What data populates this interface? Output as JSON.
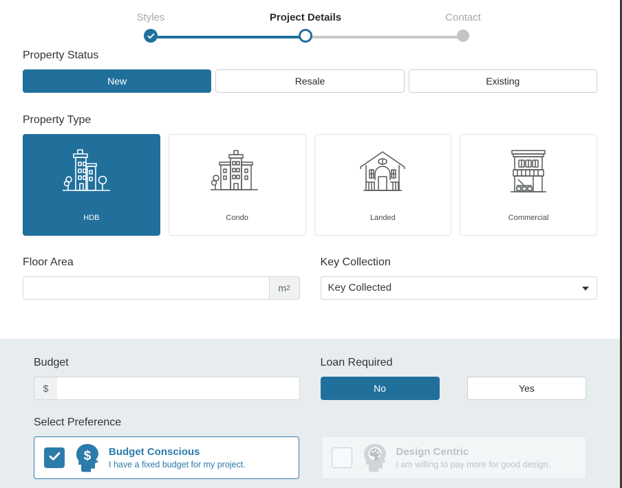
{
  "theme": {
    "accent": "#21709c",
    "accent_light": "#2b7bab",
    "panel_bg": "#e7ecef",
    "muted": "#bcc3c7"
  },
  "stepper": {
    "steps": [
      {
        "label": "Styles",
        "state": "done",
        "icon": "check-icon"
      },
      {
        "label": "Project Details",
        "state": "active",
        "icon": "circle-icon"
      },
      {
        "label": "Contact",
        "state": "todo",
        "icon": "dot-icon"
      }
    ]
  },
  "property_status": {
    "label": "Property Status",
    "options": [
      {
        "label": "New",
        "selected": true
      },
      {
        "label": "Resale",
        "selected": false
      },
      {
        "label": "Existing",
        "selected": false
      }
    ]
  },
  "property_type": {
    "label": "Property Type",
    "options": [
      {
        "label": "HDB",
        "icon": "apartment-buildings-icon",
        "selected": true
      },
      {
        "label": "Condo",
        "icon": "condo-building-icon",
        "selected": false
      },
      {
        "label": "Landed",
        "icon": "house-icon",
        "selected": false
      },
      {
        "label": "Commercial",
        "icon": "shophouse-icon",
        "selected": false
      }
    ]
  },
  "floor_area": {
    "label": "Floor Area",
    "value": "",
    "placeholder": "",
    "unit": "m",
    "unit_exponent": "2"
  },
  "key_collection": {
    "label": "Key Collection",
    "value": "Key Collected",
    "options": [
      "Key Collected"
    ]
  },
  "budget": {
    "label": "Budget",
    "currency_symbol": "$",
    "value": "",
    "placeholder": ""
  },
  "loan_required": {
    "label": "Loan Required",
    "options": [
      {
        "label": "No",
        "selected": true
      },
      {
        "label": "Yes",
        "selected": false
      }
    ]
  },
  "preference": {
    "label": "Select Preference",
    "options": [
      {
        "title": "Budget Conscious",
        "subtitle": "I have a fixed budget for my project.",
        "icon": "head-dollar-icon",
        "checked": true
      },
      {
        "title": "Design Centric",
        "subtitle": "I am willing to pay more for good design.",
        "icon": "head-palette-icon",
        "checked": false
      }
    ]
  }
}
